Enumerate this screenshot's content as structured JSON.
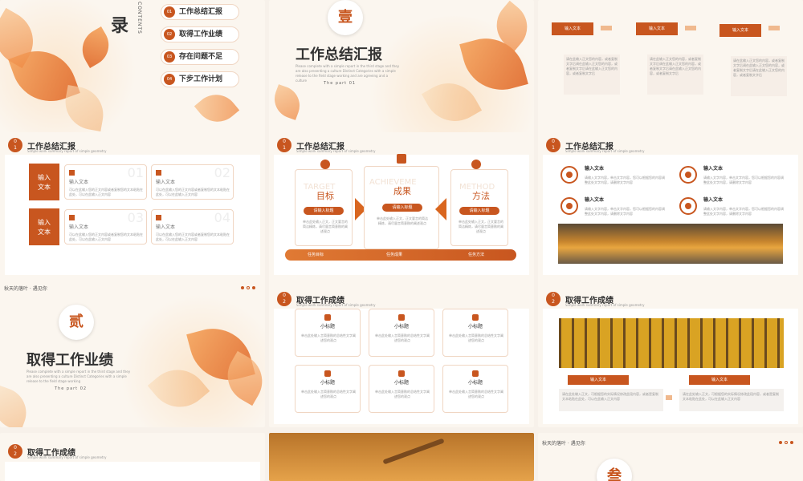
{
  "colors": {
    "accent": "#c8561f",
    "light": "#f4a25a",
    "bg": "#fbf6ef"
  },
  "s1": {
    "mark": "录",
    "contents": "CONTENTS",
    "items": [
      {
        "n": "01",
        "label": "工作总结汇报"
      },
      {
        "n": "02",
        "label": "取得工作业绩"
      },
      {
        "n": "03",
        "label": "存在问题不足"
      },
      {
        "n": "04",
        "label": "下步工作计划"
      }
    ]
  },
  "s2": {
    "seal": "壹",
    "title": "工作总结汇报",
    "sub": "Please complete with a simple report in the third stage and they are also presenting a culture Distinct Categories with a simple release to the field stage working and are agreeing and a culture",
    "part": "The part 01"
  },
  "s3": {
    "boxes": [
      {
        "label": "输入文本"
      },
      {
        "label": "输入文本"
      },
      {
        "label": "输入文本"
      }
    ],
    "text": "请在此输入正文您的内容，或者复制文字后调在此输入正文您的内容，或者复制文字后请在此输入正文您的内容，或者复制文字后"
  },
  "s4": {
    "n": "0\n1",
    "title": "工作总结汇报",
    "sub": "Simple work summary report of simple geometry",
    "side": [
      "输入\n文本",
      "输入\n文本"
    ],
    "cards": [
      {
        "num": "01",
        "head": "输入文本",
        "text": "可以在此输入您的正文内容或者复制您的文本粘贴在此处，可以在此输入正文内容"
      },
      {
        "num": "02",
        "head": "输入文本",
        "text": "可以在此输入您的正文内容或者复制您的文本粘贴在此处，可以在此输入正文内容"
      },
      {
        "num": "03",
        "head": "输入文本",
        "text": "可以在此输入您的正文内容或者复制您的文本粘贴在此处，可以在此输入正文内容"
      },
      {
        "num": "04",
        "head": "输入文本",
        "text": "可以在此输入您的正文内容或者复制您的文本粘贴在此处，可以在此输入正文内容"
      }
    ]
  },
  "s5": {
    "n": "0\n1",
    "title": "工作总结汇报",
    "sub": "Simple work summary report of simple geometry",
    "cols": [
      {
        "ghost": "TARGET",
        "head": "目标",
        "btn": "请输入标题",
        "text": "单击此处输入正文，正文要言的简洁精炼，请尽量言简意赅的阐述观点"
      },
      {
        "ghost": "ACHIEVEME",
        "head": "成果",
        "btn": "请输入标题",
        "text": "单击此处输入正文，正文要言的简洁精炼，请尽量言简意赅的阐述观点"
      },
      {
        "ghost": "METHOD",
        "head": "方法",
        "btn": "请输入标题",
        "text": "单击此处输入正文，正文要言的简洁精炼，请尽量言简意赅的阐述观点"
      }
    ],
    "footer": [
      "任务目标",
      "任务成果",
      "任务方法"
    ]
  },
  "s6": {
    "n": "0\n1",
    "title": "工作总结汇报",
    "sub": "Simple work summary report of simple geometry",
    "items": [
      {
        "head": "输入文本",
        "text": "请输入文字内容，单击文字内容，您可以根据您的内容调整此处文字内容，请删除文字内容"
      },
      {
        "head": "输入文本",
        "text": "请输入文字内容，单击文字内容，您可以根据您的内容调整此处文字内容，请删除文字内容"
      },
      {
        "head": "输入文本",
        "text": "请输入文字内容，单击文字内容，您可以根据您的内容调整此处文字内容，请删除文字内容"
      },
      {
        "head": "输入文本",
        "text": "请输入文字内容，单击文字内容，您可以根据您的内容调整此处文字内容，请删除文字内容"
      }
    ]
  },
  "s7": {
    "top": "秋天的落叶 · 遇见你",
    "seal": "贰",
    "title": "取得工作业绩",
    "sub": "Please complete with a simple report in the third stage and they are also presenting a culture Distinct Categories with a simple release to the field stage working",
    "part": "The part 02"
  },
  "s8": {
    "n": "0\n2",
    "title": "取得工作成绩",
    "sub": "Simple work summary report of simple geometry",
    "cards": [
      {
        "head": "小标题",
        "text": "单击此处输入言简意赅的总结性文字阐述您的观点"
      },
      {
        "head": "小标题",
        "text": "单击此处输入言简意赅的总结性文字阐述您的观点"
      },
      {
        "head": "小标题",
        "text": "单击此处输入言简意赅的总结性文字阐述您的观点"
      },
      {
        "head": "小标题",
        "text": "单击此处输入言简意赅的总结性文字阐述您的观点"
      },
      {
        "head": "小标题",
        "text": "单击此处输入言简意赅的总结性文字阐述您的观点"
      },
      {
        "head": "小标题",
        "text": "单击此处输入言简意赅的总结性文字阐述您的观点"
      }
    ]
  },
  "s9": {
    "n": "0\n2",
    "title": "取得工作成绩",
    "sub": "Simple work summary report of simple geometry",
    "boxes": [
      {
        "label": "输入文本",
        "text": "请在此处输入正文，可根据您的实际情况修改此段内容，或者是复制文本粘贴在此处，可以在此输入正文内容"
      },
      {
        "label": "输入文本",
        "text": "请在此处输入正文，可根据您的实际情况修改此段内容，或者是复制文本粘贴在此处，可以在此输入正文内容"
      }
    ]
  },
  "s10": {
    "n": "0\n2",
    "title": "取得工作成绩",
    "sub": "Simple work summary report of simple geometry"
  },
  "s12": {
    "top": "秋天的落叶 · 遇见你",
    "seal": "叁"
  }
}
